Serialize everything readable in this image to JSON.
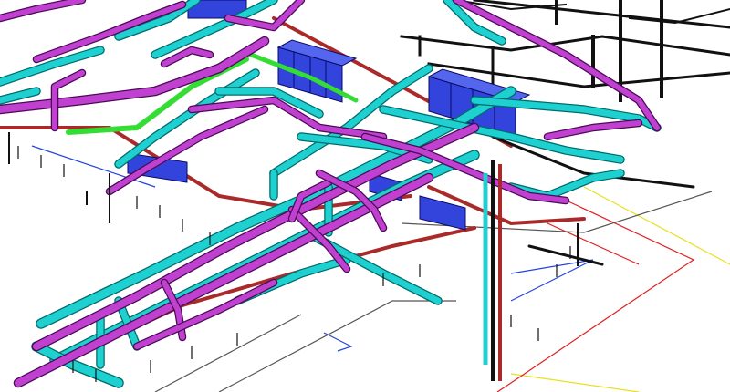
{
  "colors": {
    "background": "#ffffff",
    "duct_cyan": "#1fd0d0",
    "duct_cyan_edge": "#006a6a",
    "pipe_magenta": "#c040d0",
    "pipe_magenta_edge": "#4a0a55",
    "equipment_blue": "#3344dd",
    "equipment_blue_edge": "#0a0a66",
    "pipe_green": "#33dd33",
    "pipe_red": "#aa2a2a",
    "structure_black": "#111111",
    "floor_red": "#e02020",
    "floor_yellow": "#e8e020",
    "floor_blue": "#2244dd"
  },
  "icons": {
    "view": "isometric-mep-model"
  }
}
